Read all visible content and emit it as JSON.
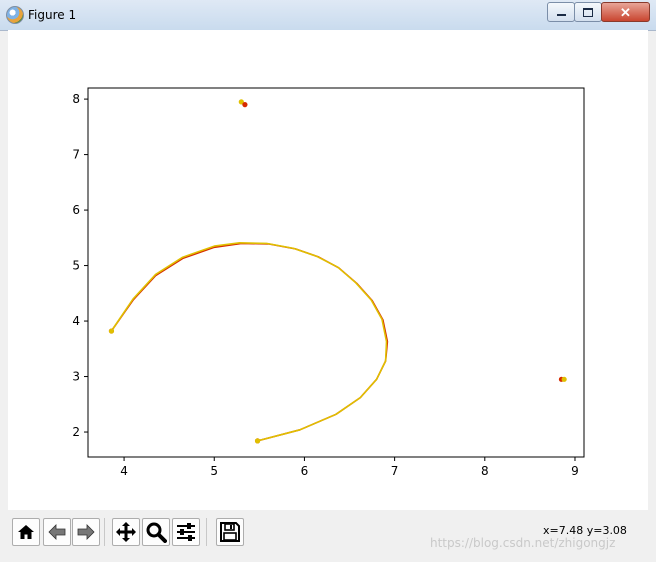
{
  "window": {
    "title": "Figure 1",
    "app_icon": "matplotlib-figure-icon",
    "controls": {
      "minimize_icon": "minimize-icon",
      "maximize_icon": "maximize-icon",
      "close_glyph": "✕"
    }
  },
  "chart_data": {
    "type": "line",
    "title": "",
    "xlabel": "",
    "ylabel": "",
    "xlim": [
      3.6,
      9.1
    ],
    "ylim": [
      1.55,
      8.2
    ],
    "xticks": [
      "4",
      "5",
      "6",
      "7",
      "8",
      "9"
    ],
    "yticks": [
      "2",
      "3",
      "4",
      "5",
      "6",
      "7",
      "8"
    ],
    "grid": false,
    "series": [
      {
        "color": "#d62a00",
        "x": [
          3.86,
          4.1,
          4.35,
          4.65,
          5.0,
          5.3,
          5.6,
          5.9,
          6.15,
          6.38,
          6.58,
          6.75,
          6.87,
          6.92,
          6.9,
          6.8,
          6.62,
          6.35,
          5.95,
          5.48
        ],
        "y": [
          3.82,
          4.38,
          4.82,
          5.13,
          5.33,
          5.4,
          5.39,
          5.3,
          5.16,
          4.96,
          4.68,
          4.37,
          4.02,
          3.63,
          3.28,
          2.95,
          2.62,
          2.32,
          2.04,
          1.84
        ]
      },
      {
        "color": "#e0c000",
        "x": [
          3.86,
          4.1,
          4.35,
          4.65,
          5.0,
          5.28,
          5.58,
          5.88,
          6.13,
          6.37,
          6.57,
          6.74,
          6.86,
          6.91,
          6.9,
          6.8,
          6.62,
          6.35,
          5.95,
          5.48
        ],
        "y": [
          3.82,
          4.4,
          4.84,
          5.15,
          5.35,
          5.41,
          5.4,
          5.31,
          5.17,
          4.97,
          4.69,
          4.38,
          4.03,
          3.63,
          3.28,
          2.95,
          2.62,
          2.32,
          2.04,
          1.84
        ]
      }
    ],
    "markers": [
      {
        "color": "#d62a00",
        "x": 3.86,
        "y": 3.82
      },
      {
        "color": "#e0c000",
        "x": 3.86,
        "y": 3.82
      },
      {
        "color": "#d62a00",
        "x": 5.48,
        "y": 1.84
      },
      {
        "color": "#e0c000",
        "x": 5.48,
        "y": 1.84
      },
      {
        "color": "#e0c000",
        "x": 5.3,
        "y": 7.95
      },
      {
        "color": "#d62a00",
        "x": 5.34,
        "y": 7.9
      },
      {
        "color": "#d62a00",
        "x": 8.85,
        "y": 2.95
      },
      {
        "color": "#e0c000",
        "x": 8.88,
        "y": 2.95
      }
    ]
  },
  "toolbar": {
    "buttons": [
      {
        "name": "home-button",
        "icon": "home-icon"
      },
      {
        "name": "back-button",
        "icon": "back-arrow-icon"
      },
      {
        "name": "forward-button",
        "icon": "forward-arrow-icon"
      },
      {
        "name": "pan-button",
        "icon": "pan-move-icon"
      },
      {
        "name": "zoom-button",
        "icon": "zoom-magnifier-icon"
      },
      {
        "name": "configure-subplots-button",
        "icon": "sliders-icon"
      },
      {
        "name": "save-button",
        "icon": "floppy-disk-icon"
      }
    ],
    "coords": "x=7.48 y=3.08"
  },
  "watermark": "https://blog.csdn.net/zhigongjz"
}
